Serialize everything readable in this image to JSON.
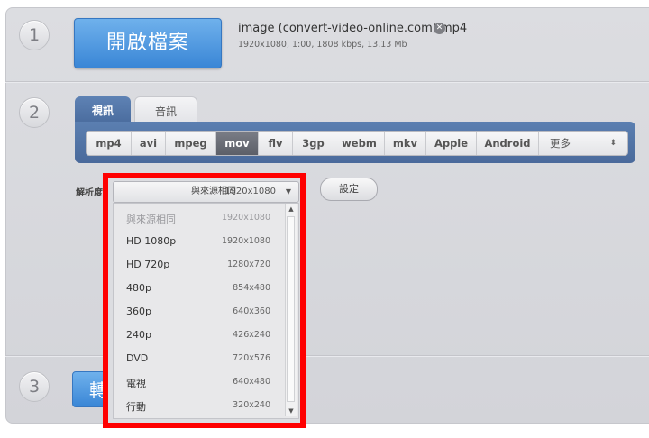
{
  "steps": {
    "one": "1",
    "two": "2",
    "three": "3"
  },
  "open_button": "開啟檔案",
  "file": {
    "name": "image (convert-video-online.com).mp4",
    "info": "1920x1080, 1:00, 1808 kbps, 13.13 Mb"
  },
  "tabs": {
    "video": "視訊",
    "audio": "音訊"
  },
  "formats": [
    "mp4",
    "avi",
    "mpeg",
    "mov",
    "flv",
    "3gp",
    "webm",
    "mkv",
    "Apple",
    "Android"
  ],
  "format_selected": "mov",
  "format_more": "更多",
  "resolution": {
    "label": "解析度:",
    "selected_label": "與來源相同",
    "selected_res": "1920x1080",
    "options": [
      {
        "label": "與來源相同",
        "res": "1920x1080"
      },
      {
        "label": "HD 1080p",
        "res": "1920x1080"
      },
      {
        "label": "HD 720p",
        "res": "1280x720"
      },
      {
        "label": "480p",
        "res": "854x480"
      },
      {
        "label": "360p",
        "res": "640x360"
      },
      {
        "label": "240p",
        "res": "426x240"
      },
      {
        "label": "DVD",
        "res": "720x576"
      },
      {
        "label": "電視",
        "res": "640x480"
      },
      {
        "label": "行動",
        "res": "320x240"
      }
    ]
  },
  "settings_button": "設定",
  "convert_button": "轉",
  "colors": {
    "accent_blue": "#3a86d6",
    "tab_blue": "#4a6c9e",
    "highlight": "#ff0000"
  }
}
